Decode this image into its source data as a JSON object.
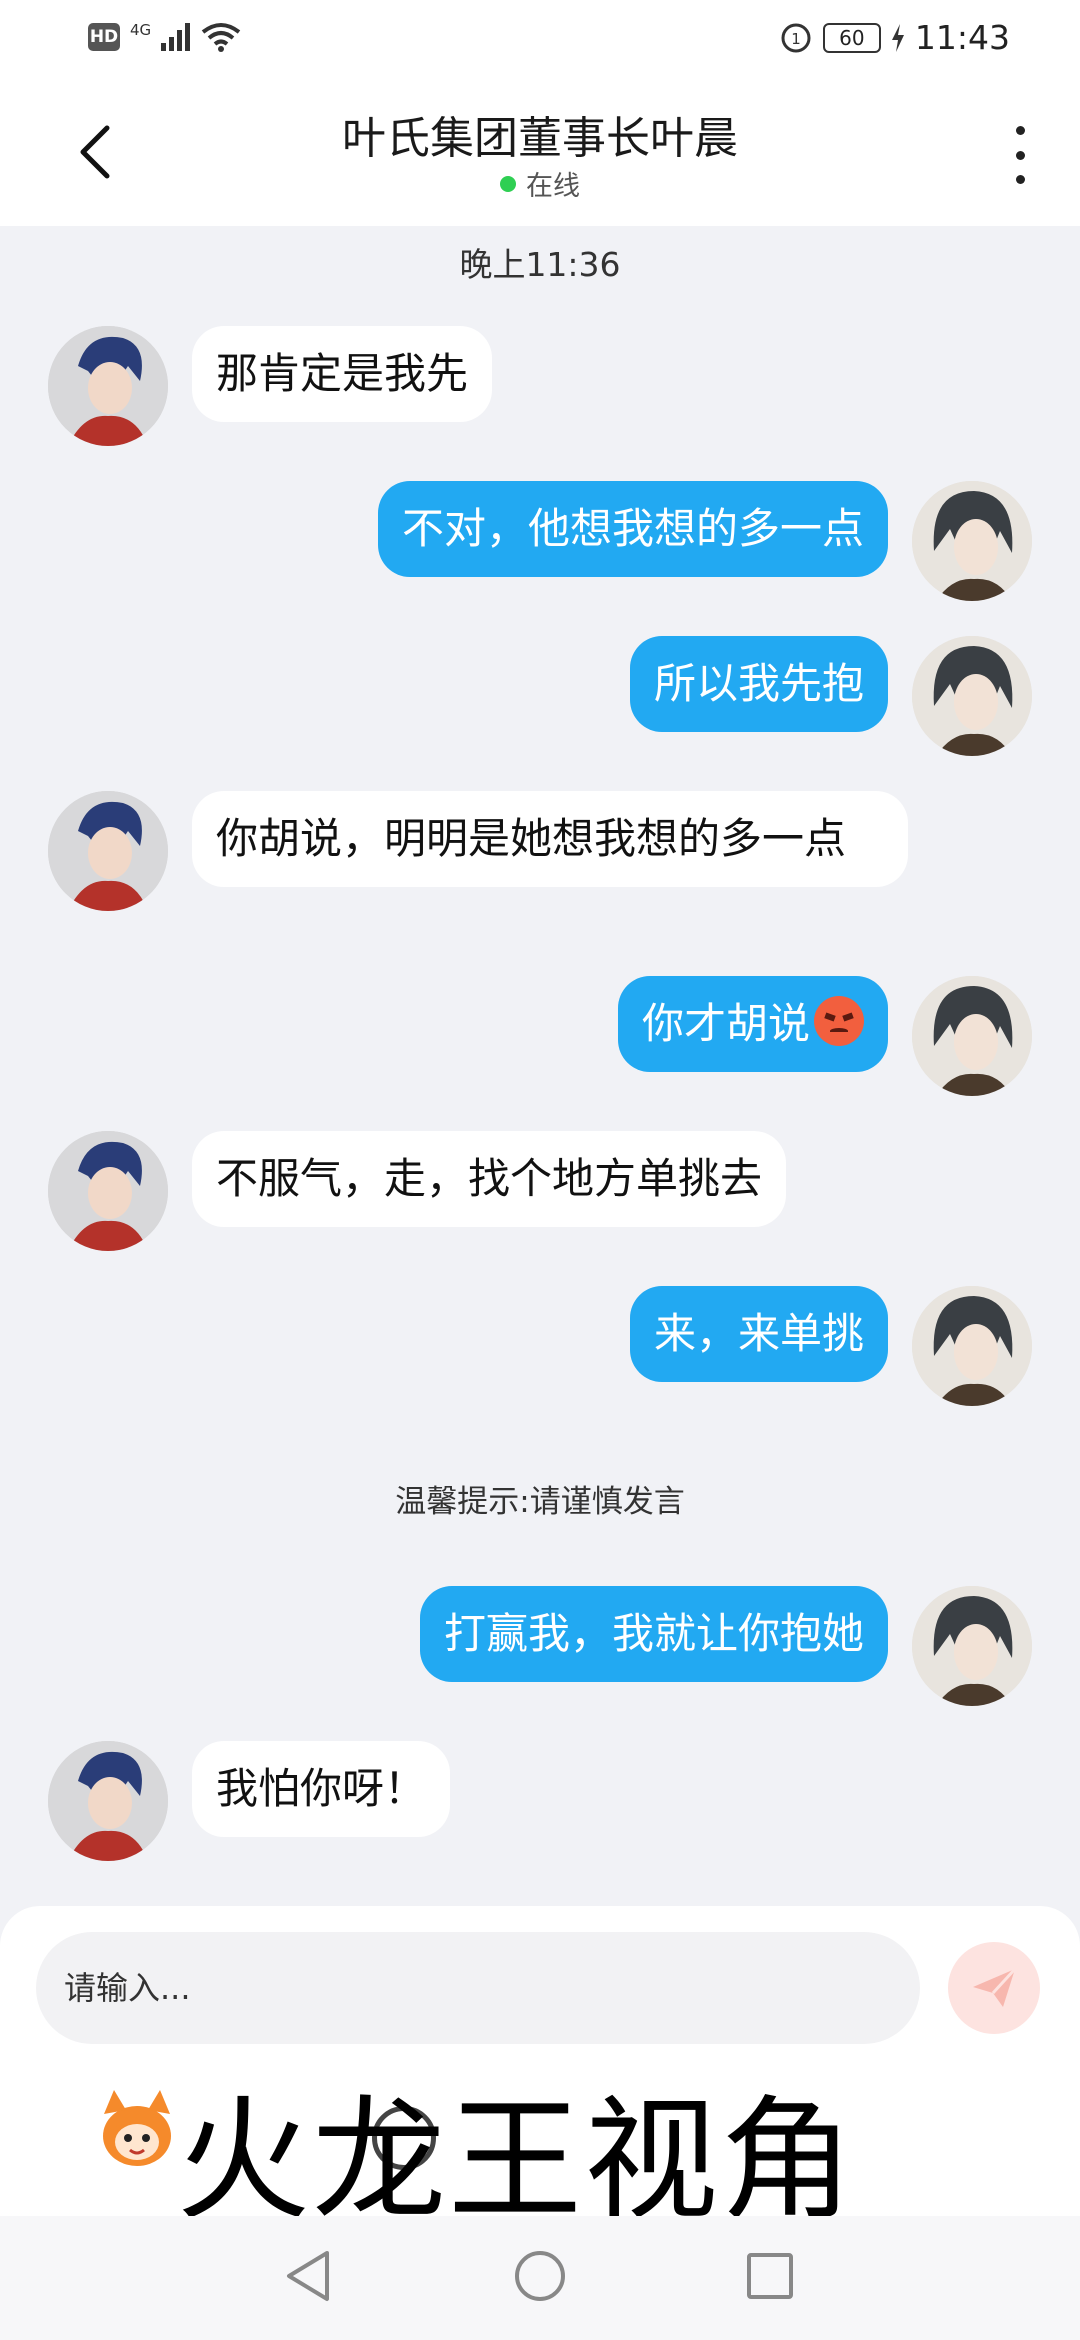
{
  "status_bar": {
    "hd_label": "HD",
    "network_label": "4G",
    "battery_level": "60",
    "time": "11:43"
  },
  "header": {
    "title": "叶氏集团董事长叶晨",
    "presence": "在线",
    "presence_color": "#2fcf53"
  },
  "chat": {
    "time_separator": "晚上11:36",
    "hint": "温馨提示:请谨慎发言",
    "messages": [
      {
        "side": "left",
        "text": "那肯定是我先"
      },
      {
        "side": "right",
        "text": "不对，他想我想的多一点"
      },
      {
        "side": "right",
        "text": "所以我先抱"
      },
      {
        "side": "left",
        "text": "你胡说，明明是她想我想的多一点"
      },
      {
        "side": "right",
        "text": "你才胡说",
        "emoji": "angry-face"
      },
      {
        "side": "left",
        "text": "不服气，走，找个地方单挑去"
      },
      {
        "side": "right",
        "text": "来，来单挑"
      },
      {
        "side": "right",
        "text": "打赢我，我就让你抱她"
      },
      {
        "side": "left",
        "text": "我怕你呀！"
      }
    ],
    "bubble_color_right": "#22a9f2",
    "bubble_color_left": "#ffffff"
  },
  "input": {
    "placeholder": "请输入..."
  },
  "watermark": {
    "text": "火龙王视角"
  }
}
